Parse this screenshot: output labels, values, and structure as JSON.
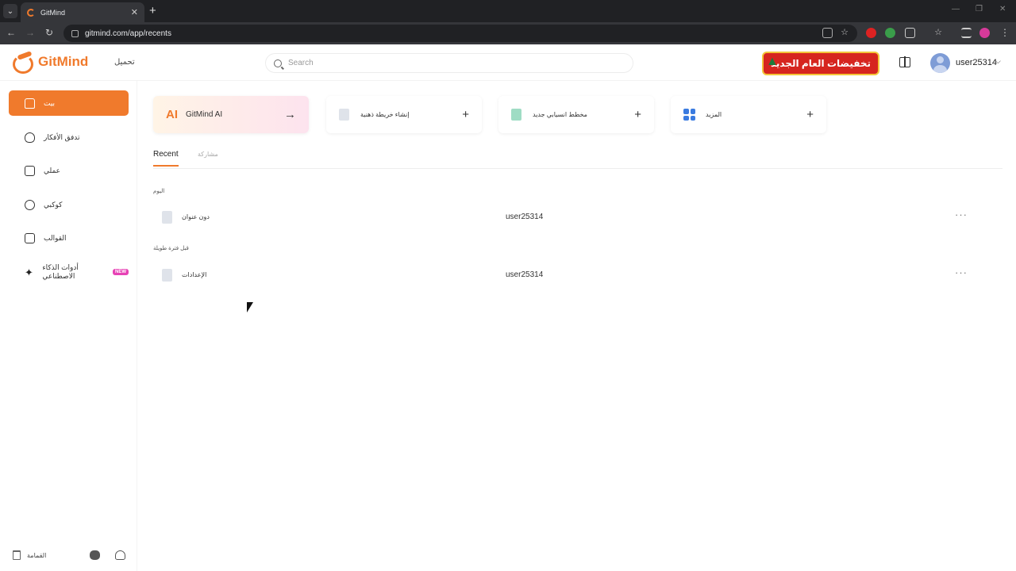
{
  "browser": {
    "tab_title": "GitMind",
    "url": "gitmind.com/app/recents"
  },
  "header": {
    "logo_text": "GitMind",
    "download_label": "تحميل",
    "search_placeholder": "Search",
    "promo_text": "تخفيضات العام الجديد",
    "user_name": "user25314"
  },
  "sidebar": {
    "items": [
      {
        "label": "بيت",
        "icon": "home-icon"
      },
      {
        "label": "تدفق الأفكار",
        "icon": "bulb-icon"
      },
      {
        "label": "عملي",
        "icon": "document-icon"
      },
      {
        "label": "كوكبي",
        "icon": "planet-icon"
      },
      {
        "label": "القوالب",
        "icon": "template-icon"
      },
      {
        "label": "أدوات الذكاء الاصطناعي",
        "icon": "sparkle-icon",
        "badge": "NEW"
      }
    ],
    "footer": {
      "trash_label": "القمامة"
    }
  },
  "quick_actions": [
    {
      "label": "GitMind AI",
      "logo": "AI",
      "action": "→"
    },
    {
      "label": "إنشاء خريطة ذهنية",
      "action": "+"
    },
    {
      "label": "مخطط انسيابي جديد",
      "action": "+"
    },
    {
      "label": "المزيد",
      "action": "+"
    }
  ],
  "tabs": {
    "recent": "Recent",
    "shared": "مشاركة"
  },
  "sections": [
    {
      "label": "اليوم",
      "files": [
        {
          "name": "دون عنوان",
          "owner": "user25314",
          "more": "···"
        }
      ]
    },
    {
      "label": "قبل فترة طويلة",
      "files": [
        {
          "name": "الإعدادات",
          "owner": "user25314",
          "more": "···"
        }
      ]
    }
  ],
  "colors": {
    "accent": "#f07a2c",
    "promo": "#d6251f",
    "new_badge": "#e742b5"
  }
}
